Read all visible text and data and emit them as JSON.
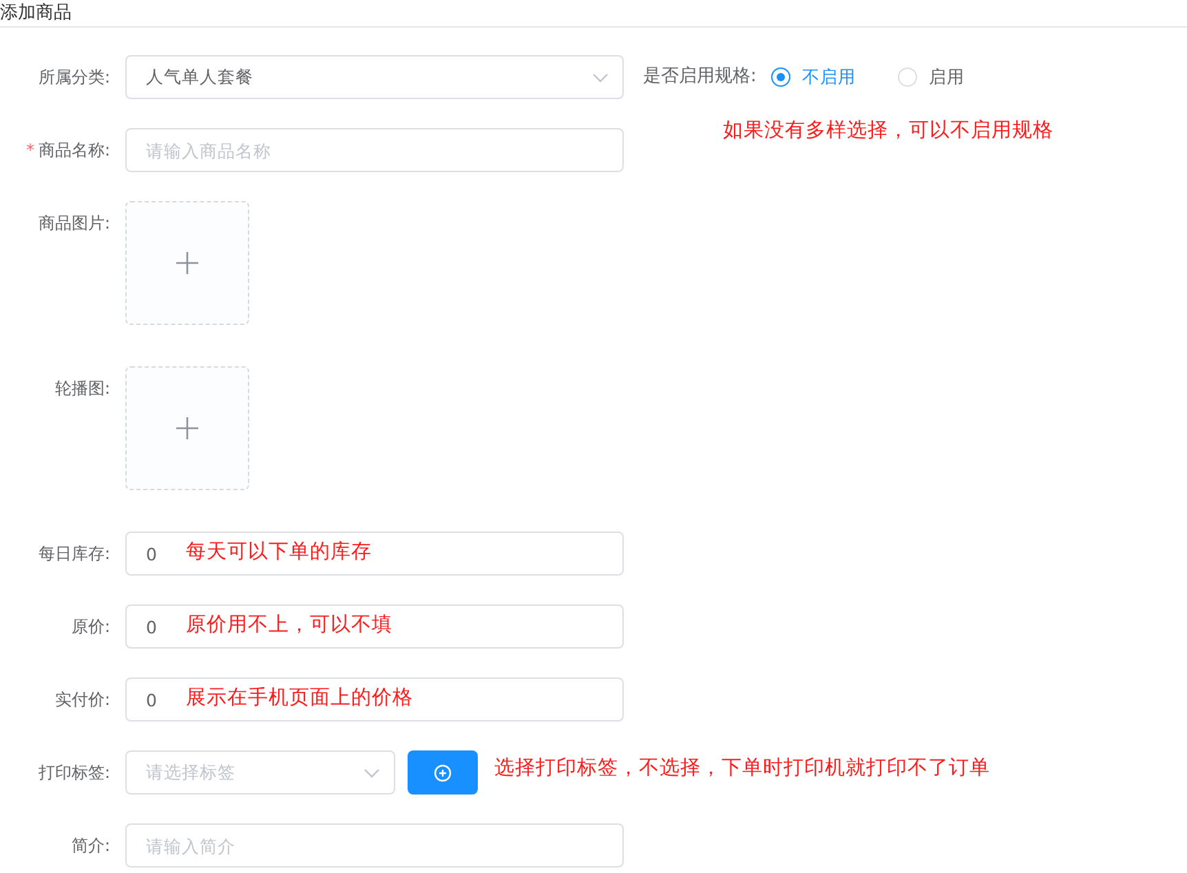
{
  "page_title": "添加商品",
  "fields": [
    {
      "kind": "select",
      "label": "所属分类:",
      "value": "人气单人套餐",
      "side": {
        "label": "是否启用规格:",
        "options": [
          {
            "label": "不启用",
            "selected": true
          },
          {
            "label": "启用",
            "selected": false
          }
        ]
      }
    },
    {
      "kind": "input",
      "label": "商品名称:",
      "required_mark": "*",
      "placeholder": "请输入商品名称",
      "side_note": "如果没有多样选择，可以不启用规格"
    },
    {
      "kind": "upload",
      "label": "商品图片:"
    },
    {
      "kind": "upload",
      "label": "轮播图:"
    },
    {
      "kind": "input",
      "label": "每日库存:",
      "value": "0",
      "inner_note": "每天可以下单的库存"
    },
    {
      "kind": "input",
      "label": "原价:",
      "value": "0",
      "inner_note": "原价用不上，可以不填"
    },
    {
      "kind": "input",
      "label": "实付价:",
      "value": "0",
      "inner_note": "展示在手机页面上的价格"
    },
    {
      "kind": "select_button",
      "label": "打印标签:",
      "placeholder": "请选择标签",
      "side_note": "选择打印标签，不选择，下单时打印机就打印不了订单"
    },
    {
      "kind": "input",
      "label": "简介:",
      "placeholder": "请输入简介"
    }
  ]
}
